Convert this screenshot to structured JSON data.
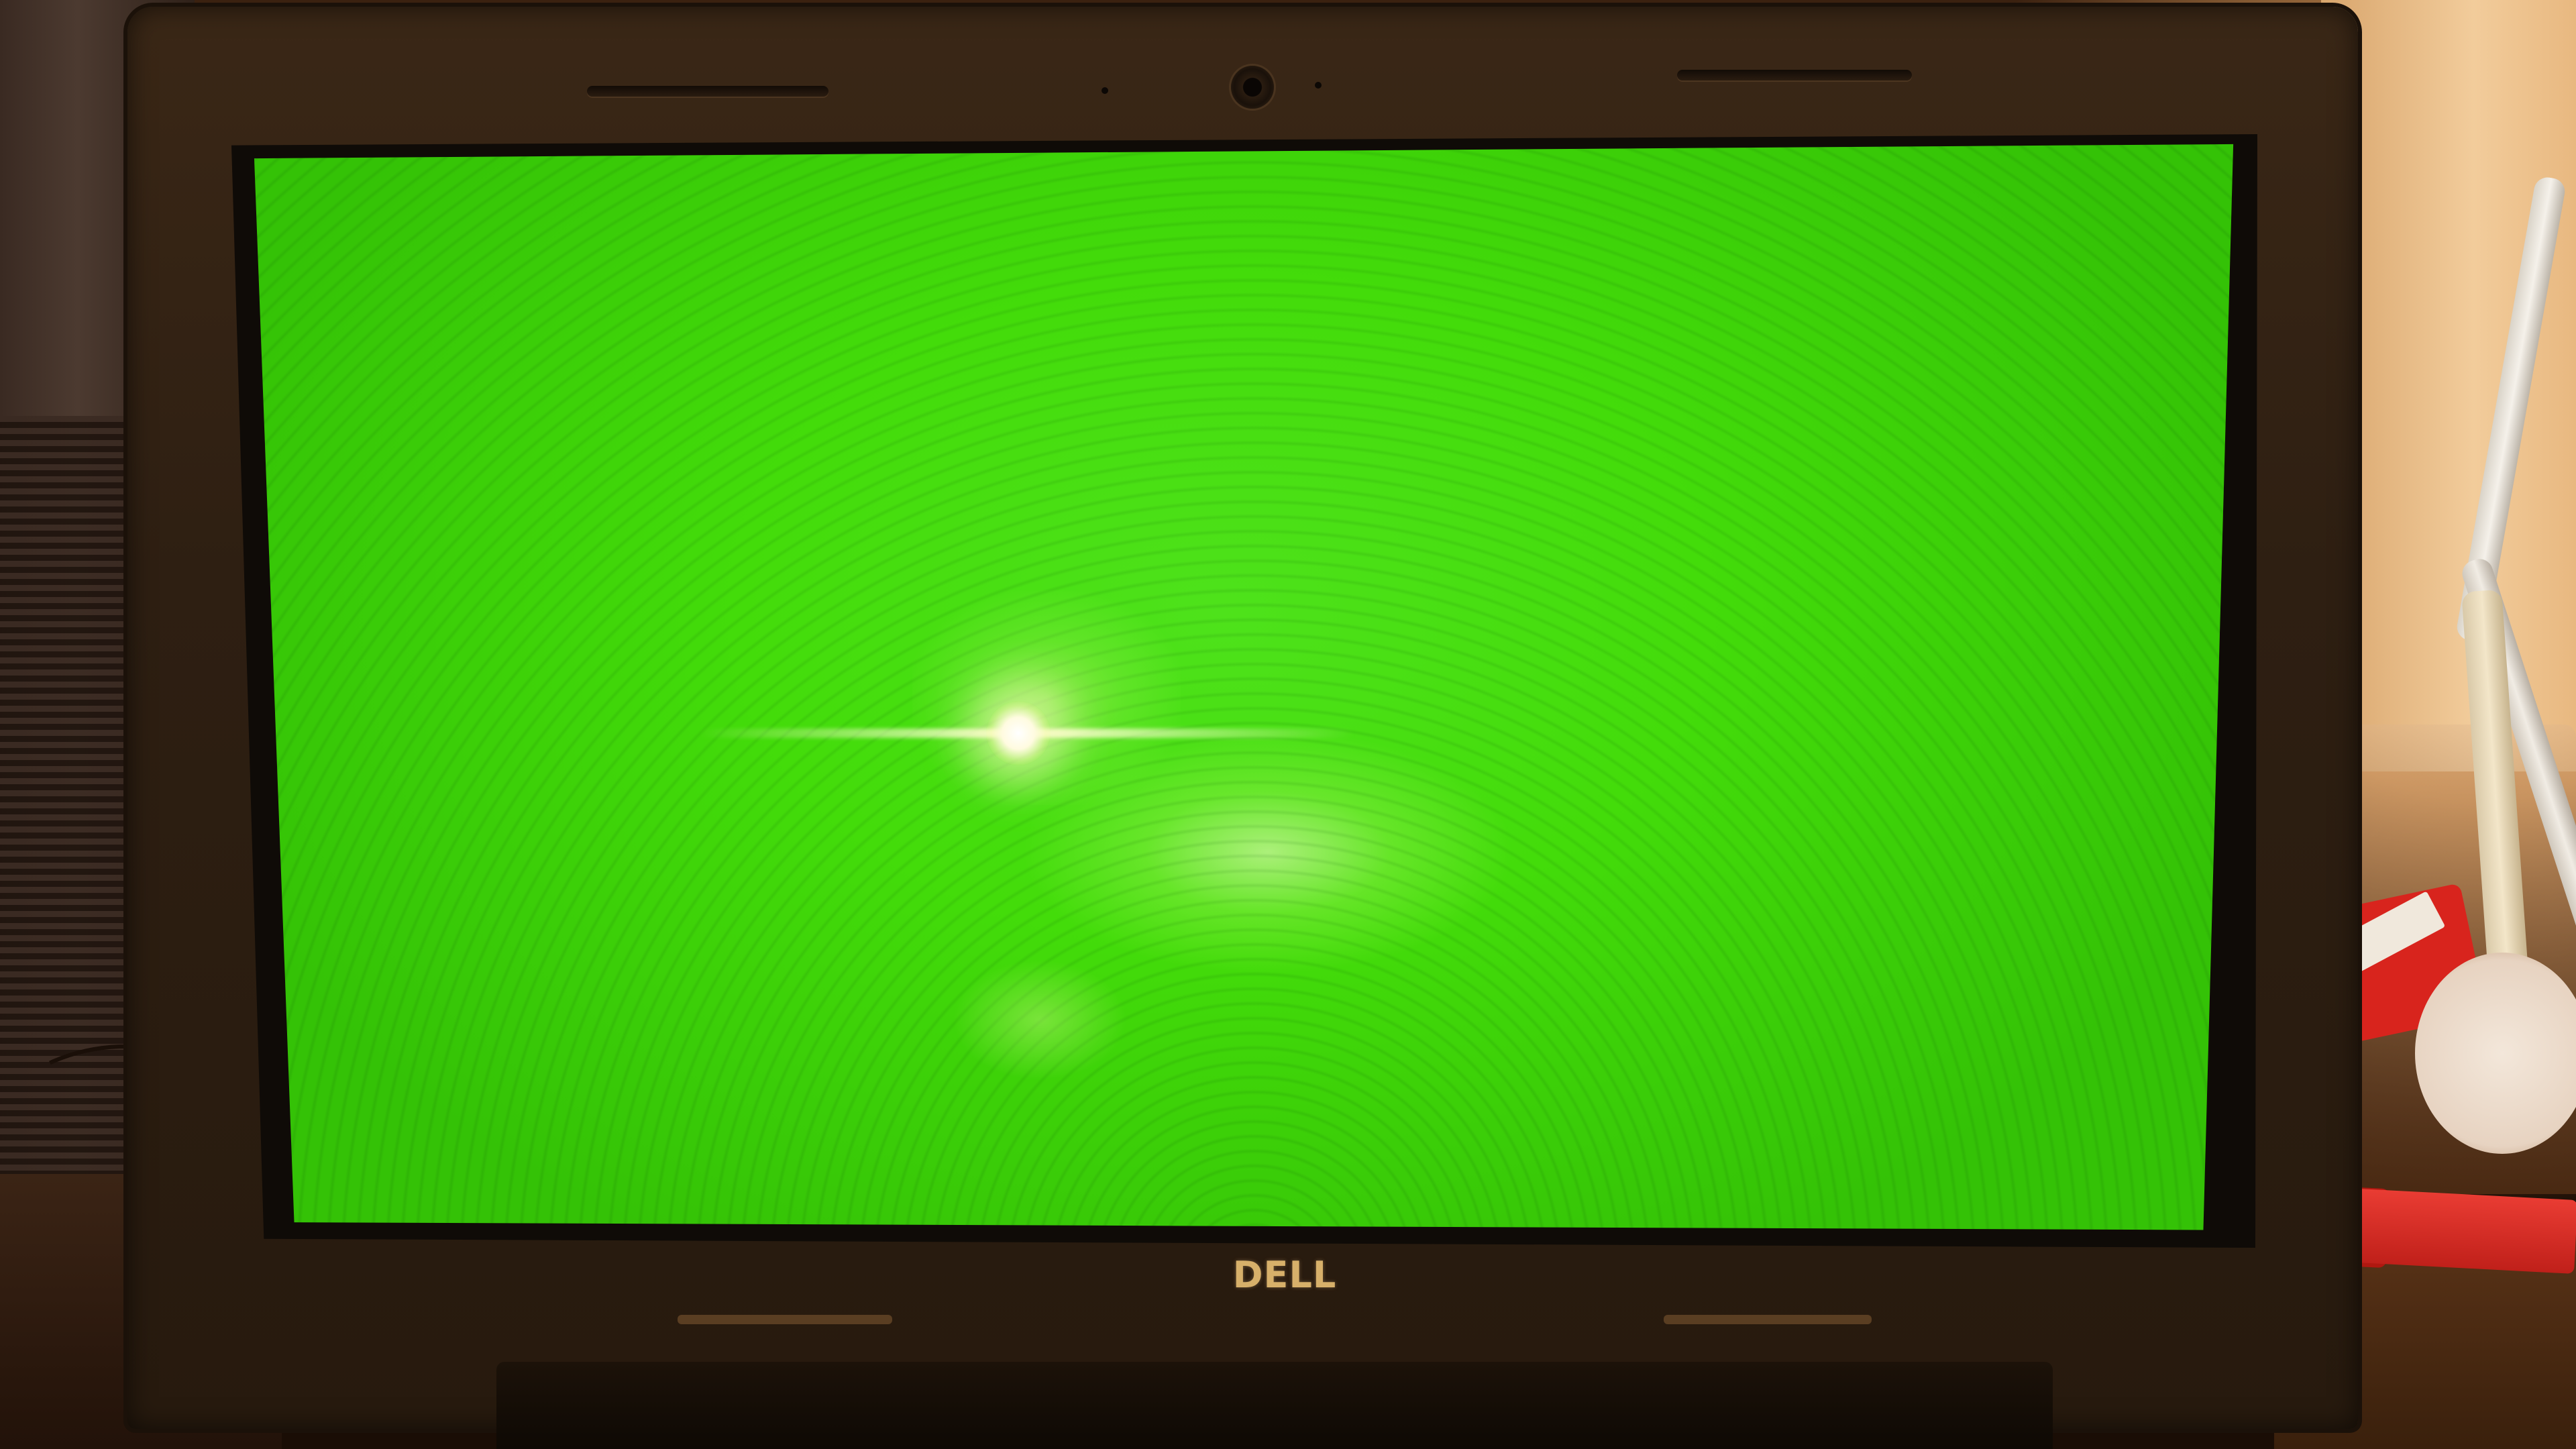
{
  "photo": {
    "subject": "laptop",
    "brand_logo_text": "DELL",
    "screen_color": "#43dc0a",
    "bezel_color": "#2e1f12",
    "glare_color": "#fffbe0",
    "ambient_light_color": "#f2cc9b"
  },
  "icons": {
    "webcam": "webcam-icon"
  }
}
